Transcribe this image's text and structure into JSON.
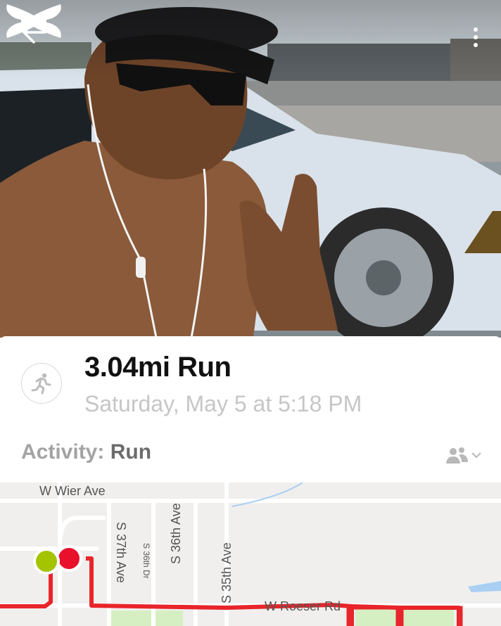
{
  "header": {
    "back_icon": "arrow-left-icon",
    "brand_logo": "under-armour-logo",
    "menu_icon": "more-vertical-icon"
  },
  "workout": {
    "icon": "running-person-icon",
    "title": "3.04mi Run",
    "date": "Saturday, May 5 at 5:18 PM",
    "activity_label": "Activity:",
    "activity_value": "Run",
    "privacy_icon": "friends-privacy-icon"
  },
  "map": {
    "streets": {
      "wier": "W Wier Ave",
      "s37th": "S 37th Ave",
      "s36thdr": "S 36th Dr",
      "s36th": "S 36th Ave",
      "s35th": "S 35th Ave",
      "roeser": "W Roeser Rd"
    },
    "start_marker_color": "#a4c400",
    "end_marker_color": "#e8102a",
    "route_color": "#e8252a"
  }
}
